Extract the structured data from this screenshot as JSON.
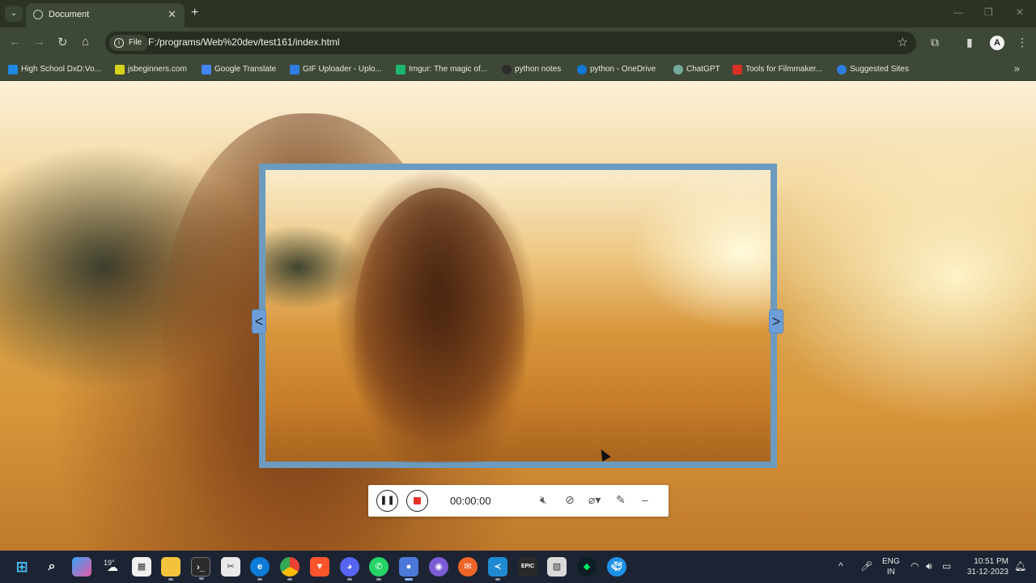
{
  "browser": {
    "tab_title": "Document",
    "tab_close": "✕",
    "new_tab": "+",
    "menu_glyph": "⌄",
    "chip_label": "File",
    "url": "F:/programs/Web%20dev/test161/index.html",
    "profile_initial": "A"
  },
  "bookmarks": [
    {
      "label": "High School DxD:Vo...",
      "color": "#1e88e5"
    },
    {
      "label": "jsbeginners.com",
      "color": "#d4d219"
    },
    {
      "label": "Google Translate",
      "color": "#4285f4"
    },
    {
      "label": "GIF Uploader - Uplo...",
      "color": "#2f7de1"
    },
    {
      "label": "Imgur: The magic of...",
      "color": "#1bb76e"
    },
    {
      "label": "python notes",
      "color": "#2d2d2d"
    },
    {
      "label": "python - OneDrive",
      "color": "#0f78d4"
    },
    {
      "label": "ChatGPT",
      "color": "#74aa9c"
    },
    {
      "label": "Tools for Filmmaker...",
      "color": "#d93025"
    },
    {
      "label": "Suggested Sites",
      "color": "#2f7de1"
    }
  ],
  "slider": {
    "prev_label": "<",
    "next_label": ">"
  },
  "recorder": {
    "time": "00:00:00",
    "minimize": "–"
  },
  "taskbar": {
    "weather_temp": "19°",
    "lang_top": "ENG",
    "lang_bottom": "IN",
    "time": "10:51 PM",
    "date": "31-12-2023"
  }
}
